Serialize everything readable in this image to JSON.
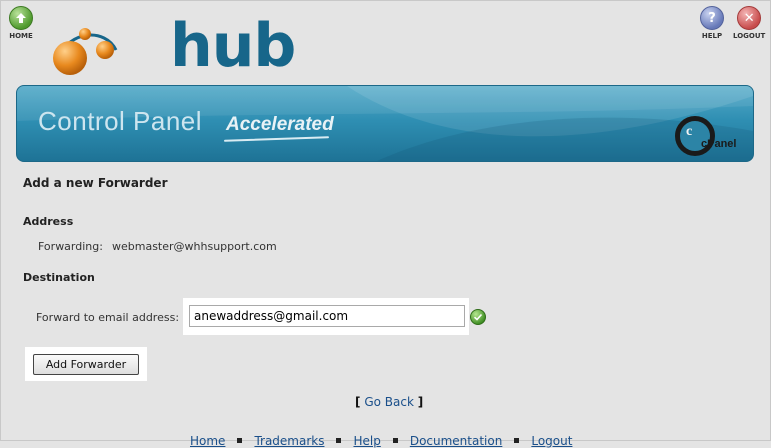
{
  "header": {
    "home_label": "HOME",
    "help_label": "HELP",
    "logout_label": "LOGOUT",
    "logo_text": "hub"
  },
  "banner": {
    "title": "Control Panel",
    "subtitle": "Accelerated",
    "cpanel_logo_text": "cPanel"
  },
  "page": {
    "title": "Add a new Forwarder",
    "address_heading": "Address",
    "forwarding_label": "Forwarding:",
    "forwarding_value": "webmaster@whhsupport.com",
    "destination_heading": "Destination",
    "forward_label": "Forward to email address:",
    "forward_value": "anewaddress@gmail.com",
    "submit_label": "Add Forwarder",
    "go_back_open": "[",
    "go_back_label": "Go Back",
    "go_back_close": "]"
  },
  "footer": {
    "links": [
      "Home",
      "Trademarks",
      "Help",
      "Documentation",
      "Logout"
    ]
  },
  "colors": {
    "banner_blue": "#2f8fb3",
    "logo_blue": "#17668a",
    "logo_orange": "#e8891e",
    "link_blue": "#1a4f8a"
  }
}
